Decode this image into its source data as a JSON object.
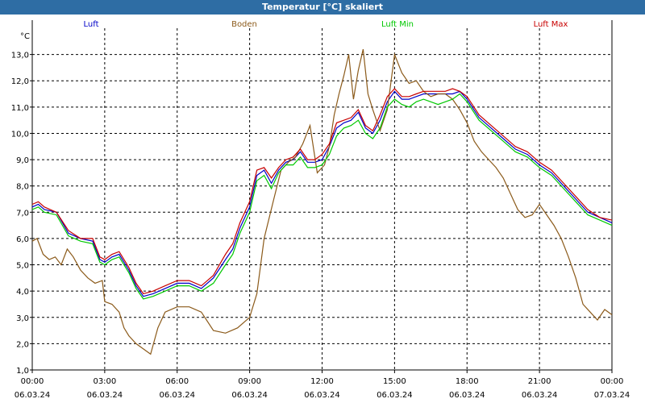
{
  "title": "Temperatur [°C] skaliert",
  "chart_data": {
    "type": "line",
    "title": "Temperatur [°C] skaliert",
    "ylabel": "°C",
    "xlabel": "",
    "ylim": [
      1.0,
      14.0
    ],
    "xlim_hours": [
      0,
      24
    ],
    "grid": true,
    "legend_position": "top",
    "y_ticks": [
      "1,0",
      "2,0",
      "3,0",
      "4,0",
      "5,0",
      "6,0",
      "7,0",
      "8,0",
      "9,0",
      "10,0",
      "11,0",
      "12,0",
      "13,0"
    ],
    "x_ticks": [
      {
        "time": "00:00",
        "date": "06.03.24"
      },
      {
        "time": "03:00",
        "date": "06.03.24"
      },
      {
        "time": "06:00",
        "date": "06.03.24"
      },
      {
        "time": "09:00",
        "date": "06.03.24"
      },
      {
        "time": "12:00",
        "date": "06.03.24"
      },
      {
        "time": "15:00",
        "date": "06.03.24"
      },
      {
        "time": "18:00",
        "date": "06.03.24"
      },
      {
        "time": "21:00",
        "date": "06.03.24"
      },
      {
        "time": "00:00",
        "date": "07.03.24"
      }
    ],
    "series": [
      {
        "name": "Luft",
        "color": "#0000c8",
        "x": [
          0,
          0.25,
          0.5,
          1,
          1.5,
          2,
          2.5,
          2.8,
          3,
          3.3,
          3.6,
          4,
          4.3,
          4.6,
          5,
          5.5,
          6,
          6.5,
          7,
          7.5,
          8,
          8.3,
          8.6,
          9,
          9.3,
          9.6,
          9.9,
          10.2,
          10.5,
          10.8,
          11.1,
          11.4,
          11.7,
          12,
          12.3,
          12.6,
          12.9,
          13.2,
          13.5,
          13.8,
          14.1,
          14.4,
          14.7,
          15,
          15.3,
          15.6,
          15.9,
          16.2,
          16.5,
          16.8,
          17.1,
          17.4,
          17.7,
          18,
          18.5,
          19,
          19.5,
          20,
          20.5,
          21,
          21.5,
          22,
          22.5,
          23,
          23.5,
          24
        ],
        "values": [
          7.2,
          7.3,
          7.1,
          7.0,
          6.2,
          6.0,
          5.9,
          5.2,
          5.1,
          5.3,
          5.4,
          4.8,
          4.2,
          3.8,
          3.9,
          4.1,
          4.3,
          4.3,
          4.1,
          4.5,
          5.2,
          5.6,
          6.4,
          7.2,
          8.4,
          8.6,
          8.1,
          8.6,
          8.9,
          9.0,
          9.3,
          8.9,
          8.9,
          9.0,
          9.5,
          10.2,
          10.4,
          10.5,
          10.8,
          10.2,
          10.0,
          10.5,
          11.2,
          11.6,
          11.3,
          11.3,
          11.4,
          11.5,
          11.5,
          11.5,
          11.5,
          11.5,
          11.6,
          11.3,
          10.6,
          10.2,
          9.8,
          9.4,
          9.2,
          8.8,
          8.5,
          8.0,
          7.5,
          7.0,
          6.8,
          6.6
        ]
      },
      {
        "name": "Boden",
        "color": "#8b5a1a",
        "x": [
          0,
          0.2,
          0.45,
          0.7,
          0.95,
          1.2,
          1.45,
          1.7,
          2.0,
          2.3,
          2.6,
          2.9,
          3.0,
          3.3,
          3.6,
          3.8,
          4.0,
          4.3,
          4.6,
          4.9,
          5.2,
          5.5,
          6.0,
          6.5,
          7.0,
          7.5,
          8.0,
          8.5,
          9.0,
          9.3,
          9.6,
          10.0,
          10.3,
          10.6,
          10.9,
          11.2,
          11.5,
          11.8,
          12.1,
          12.3,
          12.5,
          12.7,
          12.9,
          13.1,
          13.3,
          13.5,
          13.7,
          13.9,
          14.1,
          14.4,
          14.7,
          15.0,
          15.3,
          15.6,
          15.9,
          16.2,
          16.5,
          16.8,
          17.1,
          17.4,
          17.7,
          18.0,
          18.3,
          18.6,
          18.9,
          19.2,
          19.5,
          19.8,
          20.1,
          20.4,
          20.7,
          21.0,
          21.3,
          21.6,
          21.9,
          22.2,
          22.5,
          22.8,
          23.1,
          23.4,
          23.7,
          24.0
        ],
        "values": [
          5.9,
          6.0,
          5.4,
          5.2,
          5.3,
          5.0,
          5.6,
          5.3,
          4.8,
          4.5,
          4.3,
          4.4,
          3.6,
          3.5,
          3.2,
          2.6,
          2.3,
          2.0,
          1.8,
          1.6,
          2.6,
          3.2,
          3.4,
          3.4,
          3.2,
          2.5,
          2.4,
          2.6,
          3.0,
          3.9,
          6.0,
          7.5,
          8.6,
          8.9,
          9.1,
          9.6,
          10.3,
          8.5,
          8.8,
          9.5,
          10.7,
          11.5,
          12.2,
          13.0,
          11.3,
          12.4,
          13.2,
          11.5,
          10.9,
          10.1,
          10.9,
          13.0,
          12.3,
          11.9,
          12.0,
          11.6,
          11.4,
          11.5,
          11.5,
          11.3,
          10.9,
          10.4,
          9.7,
          9.3,
          9.0,
          8.7,
          8.3,
          7.7,
          7.1,
          6.8,
          6.9,
          7.3,
          6.9,
          6.5,
          6.0,
          5.3,
          4.5,
          3.5,
          3.2,
          2.9,
          3.3,
          3.1
        ]
      },
      {
        "name": "Luft Min",
        "color": "#00c800",
        "x": [
          0,
          0.25,
          0.5,
          1,
          1.5,
          2,
          2.5,
          2.8,
          3,
          3.3,
          3.6,
          4,
          4.3,
          4.6,
          5,
          5.5,
          6,
          6.5,
          7,
          7.5,
          8,
          8.3,
          8.6,
          9,
          9.3,
          9.6,
          9.9,
          10.2,
          10.5,
          10.8,
          11.1,
          11.4,
          11.7,
          12,
          12.3,
          12.6,
          12.9,
          13.2,
          13.5,
          13.8,
          14.1,
          14.4,
          14.7,
          15,
          15.3,
          15.6,
          15.9,
          16.2,
          16.5,
          16.8,
          17.1,
          17.4,
          17.7,
          18,
          18.5,
          19,
          19.5,
          20,
          20.5,
          21,
          21.5,
          22,
          22.5,
          23,
          23.5,
          24
        ],
        "values": [
          7.1,
          7.2,
          7.0,
          6.9,
          6.1,
          5.9,
          5.8,
          5.1,
          5.0,
          5.2,
          5.3,
          4.7,
          4.1,
          3.7,
          3.8,
          4.0,
          4.2,
          4.2,
          4.0,
          4.3,
          5.0,
          5.4,
          6.2,
          7.0,
          8.2,
          8.4,
          7.9,
          8.5,
          8.8,
          8.8,
          9.1,
          8.7,
          8.7,
          8.8,
          9.2,
          9.9,
          10.2,
          10.3,
          10.5,
          10.0,
          9.8,
          10.2,
          11.0,
          11.3,
          11.1,
          11.0,
          11.2,
          11.3,
          11.2,
          11.1,
          11.2,
          11.3,
          11.5,
          11.2,
          10.5,
          10.1,
          9.7,
          9.3,
          9.1,
          8.7,
          8.4,
          7.9,
          7.4,
          6.9,
          6.7,
          6.5
        ]
      },
      {
        "name": "Luft Max",
        "color": "#c80000",
        "x": [
          0,
          0.25,
          0.5,
          1,
          1.5,
          2,
          2.5,
          2.8,
          3,
          3.3,
          3.6,
          4,
          4.3,
          4.6,
          5,
          5.5,
          6,
          6.5,
          7,
          7.5,
          8,
          8.3,
          8.6,
          9,
          9.3,
          9.6,
          9.9,
          10.2,
          10.5,
          10.8,
          11.1,
          11.4,
          11.7,
          12,
          12.3,
          12.6,
          12.9,
          13.2,
          13.5,
          13.8,
          14.1,
          14.4,
          14.7,
          15,
          15.3,
          15.6,
          15.9,
          16.2,
          16.5,
          16.8,
          17.1,
          17.4,
          17.7,
          18,
          18.5,
          19,
          19.5,
          20,
          20.5,
          21,
          21.5,
          22,
          22.5,
          23,
          23.5,
          24
        ],
        "values": [
          7.3,
          7.4,
          7.2,
          7.0,
          6.3,
          6.0,
          6.0,
          5.3,
          5.2,
          5.4,
          5.5,
          4.9,
          4.3,
          3.9,
          4.0,
          4.2,
          4.4,
          4.4,
          4.2,
          4.6,
          5.4,
          5.8,
          6.6,
          7.4,
          8.6,
          8.7,
          8.3,
          8.7,
          9.0,
          9.1,
          9.4,
          9.0,
          9.0,
          9.2,
          9.6,
          10.4,
          10.5,
          10.6,
          10.9,
          10.3,
          10.1,
          10.7,
          11.4,
          11.7,
          11.4,
          11.4,
          11.5,
          11.6,
          11.6,
          11.6,
          11.6,
          11.7,
          11.6,
          11.4,
          10.7,
          10.3,
          9.9,
          9.5,
          9.3,
          8.9,
          8.6,
          8.1,
          7.6,
          7.1,
          6.8,
          6.7
        ]
      }
    ]
  }
}
